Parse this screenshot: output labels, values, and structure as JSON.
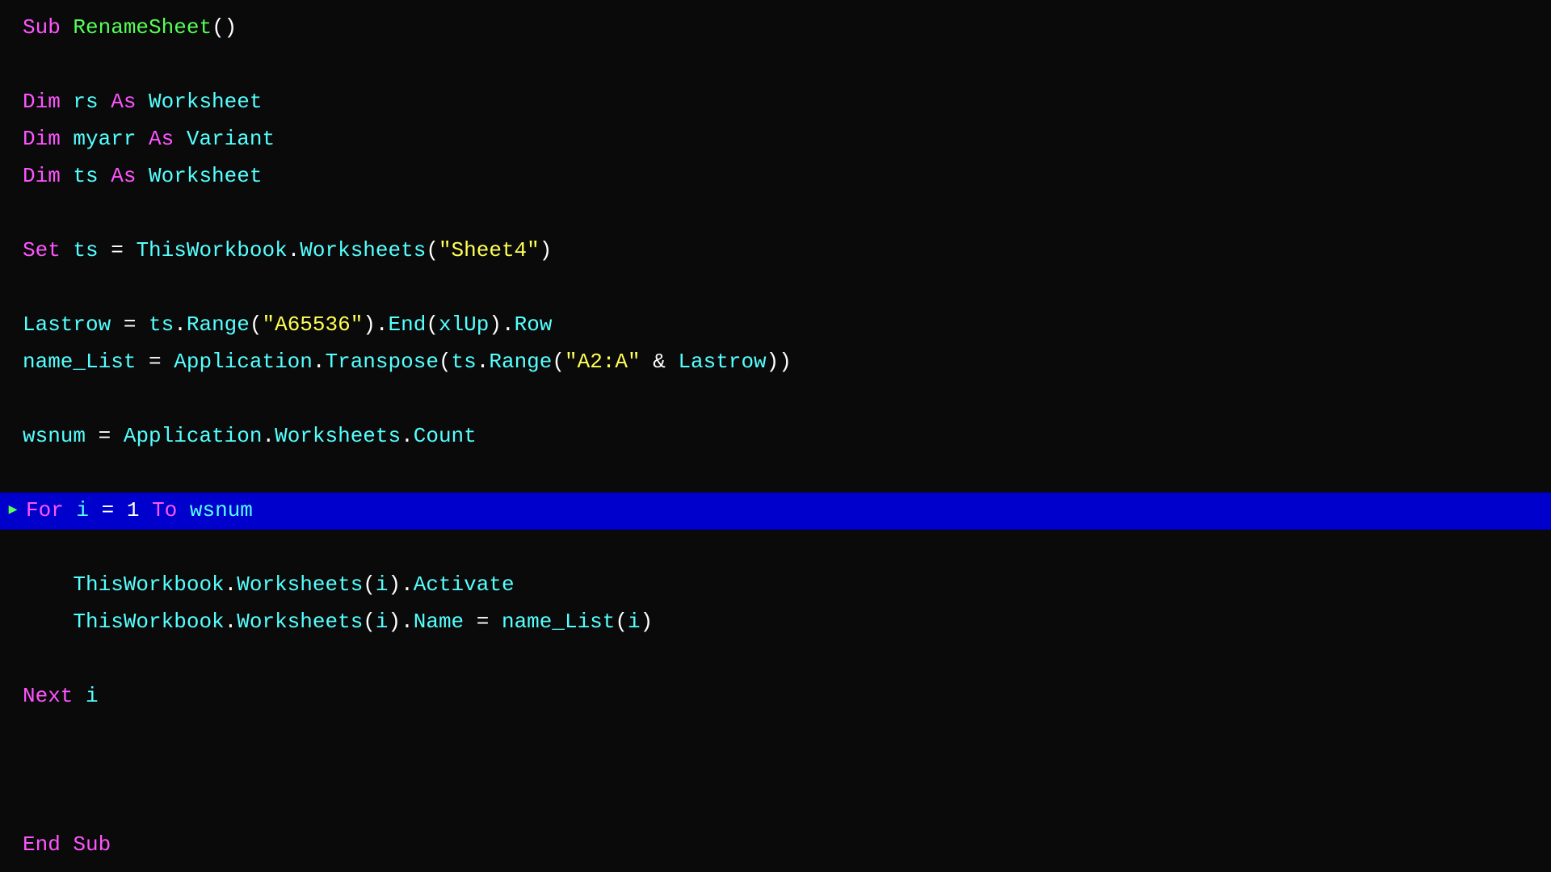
{
  "editor": {
    "background": "#0a0a0a",
    "lines": [
      {
        "id": 1,
        "marker": "",
        "content": "Sub RenameSheet()",
        "highlighted": false,
        "parts": [
          {
            "text": "Sub ",
            "class": "keyword-color"
          },
          {
            "text": "RenameSheet",
            "class": "name-color"
          },
          {
            "text": "()",
            "class": "white-color"
          }
        ]
      },
      {
        "id": 2,
        "marker": "",
        "content": "",
        "highlighted": false,
        "empty": true
      },
      {
        "id": 3,
        "marker": "",
        "content": "Dim rs As Worksheet",
        "highlighted": false,
        "parts": [
          {
            "text": "Dim ",
            "class": "keyword-color"
          },
          {
            "text": "rs ",
            "class": "var-color"
          },
          {
            "text": "As ",
            "class": "keyword-color"
          },
          {
            "text": "Worksheet",
            "class": "type-color"
          }
        ]
      },
      {
        "id": 4,
        "marker": "",
        "content": "Dim myarr As Variant",
        "highlighted": false,
        "parts": [
          {
            "text": "Dim ",
            "class": "keyword-color"
          },
          {
            "text": "myarr ",
            "class": "var-color"
          },
          {
            "text": "As ",
            "class": "keyword-color"
          },
          {
            "text": "Variant",
            "class": "type-color"
          }
        ]
      },
      {
        "id": 5,
        "marker": "",
        "content": "Dim ts As Worksheet",
        "highlighted": false,
        "parts": [
          {
            "text": "Dim ",
            "class": "keyword-color"
          },
          {
            "text": "ts ",
            "class": "var-color"
          },
          {
            "text": "As ",
            "class": "keyword-color"
          },
          {
            "text": "Worksheet",
            "class": "type-color"
          }
        ]
      },
      {
        "id": 6,
        "marker": "",
        "content": "",
        "highlighted": false,
        "empty": true
      },
      {
        "id": 7,
        "marker": "",
        "content": "Set ts = ThisWorkbook.Worksheets(\"Sheet4\")",
        "highlighted": false,
        "parts": [
          {
            "text": "Set ",
            "class": "keyword-color"
          },
          {
            "text": "ts ",
            "class": "var-color"
          },
          {
            "text": "= ",
            "class": "white-color"
          },
          {
            "text": "ThisWorkbook",
            "class": "var-color"
          },
          {
            "text": ".",
            "class": "white-color"
          },
          {
            "text": "Worksheets",
            "class": "method-color"
          },
          {
            "text": "(",
            "class": "white-color"
          },
          {
            "text": "\"Sheet4\"",
            "class": "string-color"
          },
          {
            "text": ")",
            "class": "white-color"
          }
        ]
      },
      {
        "id": 8,
        "marker": "",
        "content": "",
        "highlighted": false,
        "empty": true
      },
      {
        "id": 9,
        "marker": "",
        "content": "Lastrow = ts.Range(\"A65536\").End(xlUp).Row",
        "highlighted": false,
        "parts": [
          {
            "text": "Lastrow ",
            "class": "var-color"
          },
          {
            "text": "= ",
            "class": "white-color"
          },
          {
            "text": "ts",
            "class": "var-color"
          },
          {
            "text": ".",
            "class": "white-color"
          },
          {
            "text": "Range",
            "class": "method-color"
          },
          {
            "text": "(",
            "class": "white-color"
          },
          {
            "text": "\"A65536\"",
            "class": "string-color"
          },
          {
            "text": ").",
            "class": "white-color"
          },
          {
            "text": "End",
            "class": "method-color"
          },
          {
            "text": "(",
            "class": "white-color"
          },
          {
            "text": "xlUp",
            "class": "var-color"
          },
          {
            "text": ").",
            "class": "white-color"
          },
          {
            "text": "Row",
            "class": "method-color"
          }
        ]
      },
      {
        "id": 10,
        "marker": "",
        "content": "name_List = Application.Transpose(ts.Range(\"A2:A\" & Lastrow))",
        "highlighted": false,
        "parts": [
          {
            "text": "name_List ",
            "class": "var-color"
          },
          {
            "text": "= ",
            "class": "white-color"
          },
          {
            "text": "Application",
            "class": "var-color"
          },
          {
            "text": ".",
            "class": "white-color"
          },
          {
            "text": "Transpose",
            "class": "method-color"
          },
          {
            "text": "(",
            "class": "white-color"
          },
          {
            "text": "ts",
            "class": "var-color"
          },
          {
            "text": ".",
            "class": "white-color"
          },
          {
            "text": "Range",
            "class": "method-color"
          },
          {
            "text": "(",
            "class": "white-color"
          },
          {
            "text": "\"A2:A\"",
            "class": "string-color"
          },
          {
            "text": " & ",
            "class": "white-color"
          },
          {
            "text": "Lastrow",
            "class": "var-color"
          },
          {
            "text": "))",
            "class": "white-color"
          }
        ]
      },
      {
        "id": 11,
        "marker": "",
        "content": "",
        "highlighted": false,
        "empty": true
      },
      {
        "id": 12,
        "marker": "",
        "content": "wsnum = Application.Worksheets.Count",
        "highlighted": false,
        "parts": [
          {
            "text": "wsnum ",
            "class": "var-color"
          },
          {
            "text": "= ",
            "class": "white-color"
          },
          {
            "text": "Application",
            "class": "var-color"
          },
          {
            "text": ".",
            "class": "white-color"
          },
          {
            "text": "Worksheets",
            "class": "method-color"
          },
          {
            "text": ".",
            "class": "white-color"
          },
          {
            "text": "Count",
            "class": "method-color"
          }
        ]
      },
      {
        "id": 13,
        "marker": "",
        "content": "",
        "highlighted": false,
        "empty": true
      },
      {
        "id": 14,
        "marker": "▶",
        "content": "For i = 1 To wsnum",
        "highlighted": true,
        "parts": [
          {
            "text": "For ",
            "class": "keyword-color"
          },
          {
            "text": "i ",
            "class": "var-color"
          },
          {
            "text": "= ",
            "class": "white-color"
          },
          {
            "text": "1 ",
            "class": "white-color"
          },
          {
            "text": "To ",
            "class": "keyword-color"
          },
          {
            "text": "wsnum",
            "class": "var-color"
          }
        ]
      },
      {
        "id": 15,
        "marker": "",
        "content": "",
        "highlighted": false,
        "empty": true
      },
      {
        "id": 16,
        "marker": "",
        "content": "    ThisWorkbook.Worksheets(i).Activate",
        "highlighted": false,
        "indent": true,
        "parts": [
          {
            "text": "    ",
            "class": "white-color"
          },
          {
            "text": "ThisWorkbook",
            "class": "var-color"
          },
          {
            "text": ".",
            "class": "white-color"
          },
          {
            "text": "Worksheets",
            "class": "method-color"
          },
          {
            "text": "(",
            "class": "white-color"
          },
          {
            "text": "i",
            "class": "var-color"
          },
          {
            "text": ").",
            "class": "white-color"
          },
          {
            "text": "Activate",
            "class": "method-color"
          }
        ]
      },
      {
        "id": 17,
        "marker": "",
        "content": "    ThisWorkbook.Worksheets(i).Name = name_List(i)",
        "highlighted": false,
        "indent": true,
        "parts": [
          {
            "text": "    ",
            "class": "white-color"
          },
          {
            "text": "ThisWorkbook",
            "class": "var-color"
          },
          {
            "text": ".",
            "class": "white-color"
          },
          {
            "text": "Worksheets",
            "class": "method-color"
          },
          {
            "text": "(",
            "class": "white-color"
          },
          {
            "text": "i",
            "class": "var-color"
          },
          {
            "text": ").",
            "class": "white-color"
          },
          {
            "text": "Name ",
            "class": "method-color"
          },
          {
            "text": "= ",
            "class": "white-color"
          },
          {
            "text": "name_List",
            "class": "var-color"
          },
          {
            "text": "(",
            "class": "white-color"
          },
          {
            "text": "i",
            "class": "var-color"
          },
          {
            "text": ")",
            "class": "white-color"
          }
        ]
      },
      {
        "id": 18,
        "marker": "",
        "content": "",
        "highlighted": false,
        "empty": true
      },
      {
        "id": 19,
        "marker": "",
        "content": "Next i",
        "highlighted": false,
        "parts": [
          {
            "text": "Next ",
            "class": "keyword-color"
          },
          {
            "text": "i",
            "class": "var-color"
          }
        ]
      },
      {
        "id": 20,
        "marker": "",
        "content": "",
        "highlighted": false,
        "empty": true
      },
      {
        "id": 21,
        "marker": "",
        "content": "",
        "highlighted": false,
        "empty": true
      },
      {
        "id": 22,
        "marker": "",
        "content": "",
        "highlighted": false,
        "empty": true
      },
      {
        "id": 23,
        "marker": "",
        "content": "End Sub",
        "highlighted": false,
        "parts": [
          {
            "text": "End ",
            "class": "keyword-color"
          },
          {
            "text": "Sub",
            "class": "keyword-color"
          }
        ]
      }
    ]
  }
}
